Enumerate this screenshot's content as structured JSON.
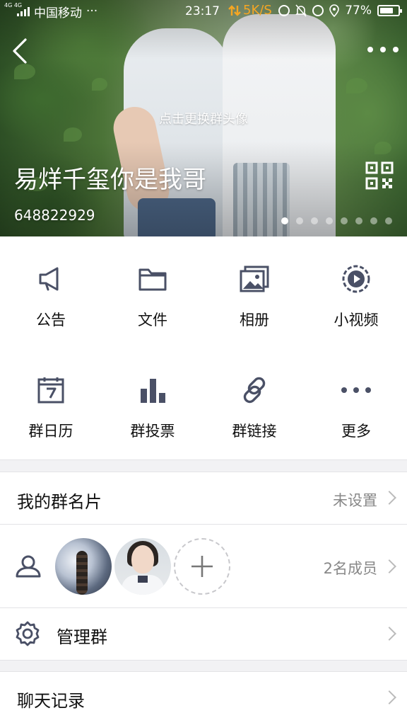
{
  "status_bar": {
    "network_tag": "4G 4G",
    "carrier": "中国移动",
    "carrier_more": "···",
    "time": "23:17",
    "speed": "5K/S",
    "battery": "77%",
    "battery_level": 0.77
  },
  "header": {
    "change_avatar_hint": "点击更换群头像",
    "group_name": "易烊千玺你是我哥",
    "group_id": "648822929",
    "page_count": 8,
    "active_page": 1
  },
  "features": [
    {
      "label": "公告",
      "icon": "megaphone-icon"
    },
    {
      "label": "文件",
      "icon": "folder-icon"
    },
    {
      "label": "相册",
      "icon": "photo-album-icon"
    },
    {
      "label": "小视频",
      "icon": "video-play-icon"
    },
    {
      "label": "群日历",
      "icon": "calendar-icon"
    },
    {
      "label": "群投票",
      "icon": "bar-chart-icon"
    },
    {
      "label": "群链接",
      "icon": "link-icon"
    },
    {
      "label": "更多",
      "icon": "more-dots-icon"
    }
  ],
  "group_card": {
    "title": "我的群名片",
    "value": "未设置"
  },
  "members": {
    "count_label": "2名成员"
  },
  "manage": {
    "title": "管理群"
  },
  "chat_history": {
    "title": "聊天记录"
  },
  "colors": {
    "icon": "#4a5066",
    "accent": "#f5a623",
    "divider": "#e3e3e6"
  }
}
